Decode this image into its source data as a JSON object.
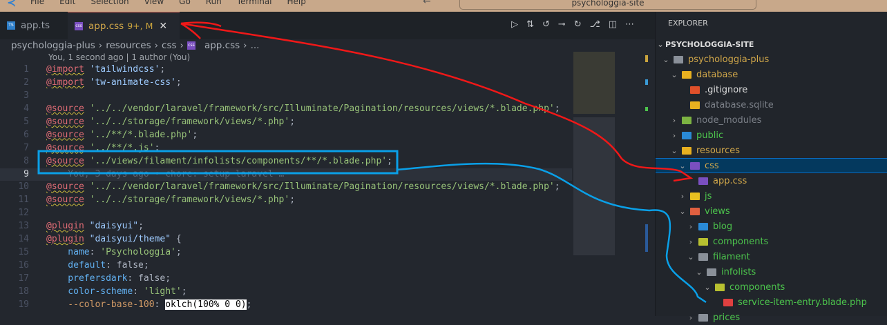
{
  "titlebar": {
    "menu": [
      "File",
      "Edit",
      "Selection",
      "View",
      "Go",
      "Run",
      "Terminal",
      "Help"
    ],
    "search": "psychologgia-site"
  },
  "tabs": [
    {
      "label": "app.ts",
      "icon": "ts-icon"
    },
    {
      "label": "app.css",
      "status": "9+, M",
      "icon": "css-icon",
      "active": true
    }
  ],
  "breadcrumb": [
    "psychologgia-plus",
    "resources",
    "css",
    "app.css",
    "..."
  ],
  "blame": "You, 1 second ago | 1 author (You)",
  "code": [
    {
      "n": "1",
      "parts": [
        [
          "at",
          "@import"
        ],
        [
          "p",
          " "
        ],
        [
          "strb",
          "'tailwindcss'"
        ],
        [
          "p",
          ";"
        ]
      ]
    },
    {
      "n": "2",
      "parts": [
        [
          "at",
          "@import"
        ],
        [
          "p",
          " "
        ],
        [
          "strb",
          "'tw-animate-css'"
        ],
        [
          "p",
          ";"
        ]
      ]
    },
    {
      "n": "3",
      "parts": []
    },
    {
      "n": "4",
      "parts": [
        [
          "at",
          "@source"
        ],
        [
          "p",
          " "
        ],
        [
          "str",
          "'../../vendor/laravel/framework/src/Illuminate/Pagination/resources/views/*.blade.php'"
        ],
        [
          "p",
          ";"
        ]
      ]
    },
    {
      "n": "5",
      "parts": [
        [
          "at",
          "@source"
        ],
        [
          "p",
          " "
        ],
        [
          "str",
          "'../../storage/framework/views/*.php'"
        ],
        [
          "p",
          ";"
        ]
      ]
    },
    {
      "n": "6",
      "parts": [
        [
          "at",
          "@source"
        ],
        [
          "p",
          " "
        ],
        [
          "str",
          "'../**/*.blade.php'"
        ],
        [
          "p",
          ";"
        ]
      ]
    },
    {
      "n": "7",
      "parts": [
        [
          "at",
          "@source"
        ],
        [
          "p",
          " "
        ],
        [
          "str",
          "'../**/*.js'"
        ],
        [
          "p",
          ";"
        ]
      ]
    },
    {
      "n": "8",
      "parts": [
        [
          "at",
          "@source"
        ],
        [
          "p",
          " "
        ],
        [
          "str",
          "'../views/filament/infolists/components/**/*.blade.php'"
        ],
        [
          "p",
          ";"
        ]
      ]
    },
    {
      "n": "9",
      "parts": [
        [
          "ghost",
          "    You, 3 days ago • chore: setup laravel …"
        ]
      ],
      "current": true
    },
    {
      "n": "10",
      "parts": [
        [
          "at",
          "@source"
        ],
        [
          "p",
          " "
        ],
        [
          "str",
          "'../../vendor/laravel/framework/src/Illuminate/Pagination/resources/views/*.blade.php'"
        ],
        [
          "p",
          ";"
        ]
      ]
    },
    {
      "n": "11",
      "parts": [
        [
          "at",
          "@source"
        ],
        [
          "p",
          " "
        ],
        [
          "str",
          "'../../storage/framework/views/*.php'"
        ],
        [
          "p",
          ";"
        ]
      ]
    },
    {
      "n": "12",
      "parts": []
    },
    {
      "n": "13",
      "parts": [
        [
          "at",
          "@plugin"
        ],
        [
          "p",
          " "
        ],
        [
          "strb",
          "\"daisyui\""
        ],
        [
          "p",
          ";"
        ]
      ]
    },
    {
      "n": "14",
      "parts": [
        [
          "at",
          "@plugin"
        ],
        [
          "p",
          " "
        ],
        [
          "strb",
          "\"daisyui/theme\""
        ],
        [
          "p",
          " {"
        ]
      ]
    },
    {
      "n": "15",
      "parts": [
        [
          "prop",
          "    name"
        ],
        [
          "p",
          ": "
        ],
        [
          "str",
          "'Psychologgia'"
        ],
        [
          "p",
          ";"
        ]
      ]
    },
    {
      "n": "16",
      "parts": [
        [
          "prop",
          "    default"
        ],
        [
          "p",
          ": false;"
        ]
      ]
    },
    {
      "n": "17",
      "parts": [
        [
          "prop",
          "    prefersdark"
        ],
        [
          "p",
          ": false;"
        ]
      ]
    },
    {
      "n": "18",
      "parts": [
        [
          "prop",
          "    color-scheme"
        ],
        [
          "p",
          ": "
        ],
        [
          "str",
          "'light'"
        ],
        [
          "p",
          ";"
        ]
      ]
    },
    {
      "n": "19",
      "parts": [
        [
          "var",
          "    --color-base-100"
        ],
        [
          "p",
          ": "
        ],
        [
          "hl",
          "oklch(100% 0 0)"
        ],
        [
          "p",
          ";"
        ]
      ]
    }
  ],
  "explorer": {
    "title": "EXPLORER",
    "root": "PSYCHOLOGGIA-SITE",
    "items": [
      {
        "label": "psychologgia-plus",
        "depth": 1,
        "chev": "open",
        "color": "y",
        "icon": "#8a9099"
      },
      {
        "label": "database",
        "depth": 2,
        "chev": "open",
        "color": "y",
        "icon": "#e8b020"
      },
      {
        "label": ".gitignore",
        "depth": 3,
        "chev": "",
        "color": "w",
        "icon": "#e0502a"
      },
      {
        "label": "database.sqlite",
        "depth": 3,
        "chev": "",
        "color": "dim",
        "icon": "#e8b020"
      },
      {
        "label": "node_modules",
        "depth": 2,
        "chev": "closed",
        "color": "dim",
        "icon": "#7cb342"
      },
      {
        "label": "public",
        "depth": 2,
        "chev": "closed",
        "color": "g",
        "icon": "#2a8ad6"
      },
      {
        "label": "resources",
        "depth": 2,
        "chev": "open",
        "color": "y",
        "icon": "#e8b020"
      },
      {
        "label": "css",
        "depth": 3,
        "chev": "open",
        "color": "y",
        "icon": "#7a4fc0",
        "selected": true
      },
      {
        "label": "app.css",
        "depth": 4,
        "chev": "",
        "color": "y",
        "icon": "#7a4fc0"
      },
      {
        "label": "js",
        "depth": 3,
        "chev": "closed",
        "color": "g",
        "icon": "#e8c020"
      },
      {
        "label": "views",
        "depth": 3,
        "chev": "open",
        "color": "g",
        "icon": "#e06040"
      },
      {
        "label": "blog",
        "depth": 4,
        "chev": "closed",
        "color": "g",
        "icon": "#2a8ad6"
      },
      {
        "label": "components",
        "depth": 4,
        "chev": "closed",
        "color": "g",
        "icon": "#b8c030"
      },
      {
        "label": "filament",
        "depth": 4,
        "chev": "open",
        "color": "g",
        "icon": "#8a9099"
      },
      {
        "label": "infolists",
        "depth": 5,
        "chev": "open",
        "color": "g",
        "icon": "#8a9099"
      },
      {
        "label": "components",
        "depth": 6,
        "chev": "open",
        "color": "g",
        "icon": "#b8c030"
      },
      {
        "label": "service-item-entry.blade.php",
        "depth": 7,
        "chev": "",
        "color": "g",
        "icon": "#e04040"
      },
      {
        "label": "prices",
        "depth": 4,
        "chev": "closed",
        "color": "g",
        "icon": "#8a9099"
      }
    ]
  }
}
